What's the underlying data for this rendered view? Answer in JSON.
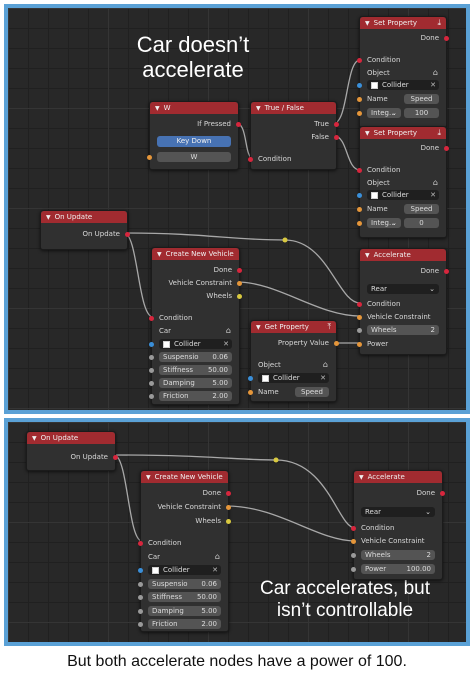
{
  "top_panel": {
    "caption": "Car doesn’t accelerate",
    "caption_line1": "Car doesn’t",
    "caption_line2": "accelerate",
    "nodes": {
      "w": {
        "title": "W",
        "if_pressed": "If Pressed",
        "key_down": "Key Down",
        "key": "W"
      },
      "true_false": {
        "title": "True / False",
        "true_label": "True",
        "false_label": "False",
        "condition": "Condition"
      },
      "set_property_1": {
        "title": "Set Property",
        "done": "Done",
        "condition": "Condition",
        "object": "Object",
        "object_value": "Collider",
        "name_label": "Name",
        "name_value": "Speed",
        "type": "Integ...",
        "value": "100"
      },
      "set_property_2": {
        "title": "Set Property",
        "done": "Done",
        "condition": "Condition",
        "object": "Object",
        "object_value": "Collider",
        "name_label": "Name",
        "name_value": "Speed",
        "type": "Integ...",
        "value": "0"
      },
      "on_update": {
        "title": "On Update",
        "output": "On Update"
      },
      "create_vehicle": {
        "title": "Create New Vehicle",
        "done": "Done",
        "vehicle_constraint": "Vehicle Constraint",
        "wheels": "Wheels",
        "condition": "Condition",
        "car": "Car",
        "car_value": "Collider",
        "suspension_label": "Suspensio",
        "suspension_value": "0.06",
        "stiffness_label": "Stiffness",
        "stiffness_value": "50.00",
        "damping_label": "Damping",
        "damping_value": "5.00",
        "friction_label": "Friction",
        "friction_value": "2.00"
      },
      "get_property": {
        "title": "Get Property",
        "property_value": "Property Value",
        "object": "Object",
        "object_value": "Collider",
        "name_label": "Name",
        "name_value": "Speed"
      },
      "accelerate": {
        "title": "Accelerate",
        "done": "Done",
        "mode": "Rear",
        "condition": "Condition",
        "vehicle_constraint": "Vehicle Constraint",
        "wheels_label": "Wheels",
        "wheels_value": "2",
        "power_label": "Power"
      }
    }
  },
  "bottom_panel": {
    "caption_line1": "Car accelerates, but",
    "caption_line2": "isn’t controllable",
    "nodes": {
      "on_update": {
        "title": "On Update",
        "output": "On Update"
      },
      "create_vehicle": {
        "title": "Create New Vehicle",
        "done": "Done",
        "vehicle_constraint": "Vehicle Constraint",
        "wheels": "Wheels",
        "condition": "Condition",
        "car": "Car",
        "car_value": "Collider",
        "suspension_label": "Suspensio",
        "suspension_value": "0.06",
        "stiffness_label": "Stiffness",
        "stiffness_value": "50.00",
        "damping_label": "Damping",
        "damping_value": "5.00",
        "friction_label": "Friction",
        "friction_value": "2.00"
      },
      "accelerate": {
        "title": "Accelerate",
        "done": "Done",
        "mode": "Rear",
        "condition": "Condition",
        "vehicle_constraint": "Vehicle Constraint",
        "wheels_label": "Wheels",
        "wheels_value": "2",
        "power_label": "Power",
        "power_value": "100.00"
      }
    }
  },
  "footer_caption": "But both accelerate nodes have a power of 100.",
  "colors": {
    "frame": "#5aa1d6",
    "node_header": "#a12b30",
    "socket_red": "#d7263d",
    "socket_yellow": "#d9c940",
    "socket_orange": "#e5963a",
    "socket_blue": "#3a8fd9"
  }
}
